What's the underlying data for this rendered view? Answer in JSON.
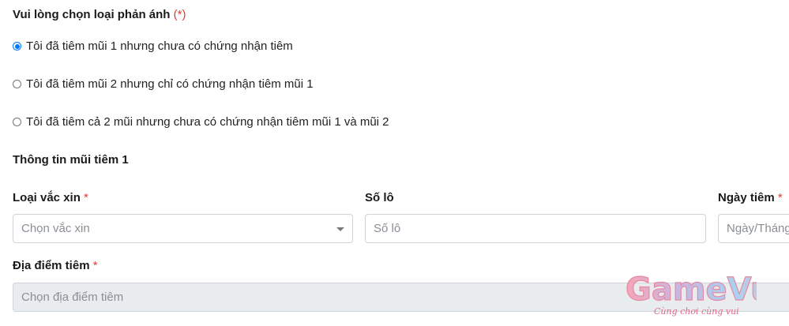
{
  "form": {
    "question": "Vui lòng chọn loại phản ánh",
    "question_required": "(*)",
    "options": [
      {
        "label": "Tôi đã tiêm mũi 1 nhưng chưa có chứng nhận tiêm",
        "checked": true
      },
      {
        "label": "Tôi đã tiêm mũi 2 nhưng chỉ có chứng nhận tiêm mũi 1",
        "checked": false
      },
      {
        "label": "Tôi đã tiêm cả 2 mũi nhưng chưa có chứng nhận tiêm mũi 1 và mũi 2",
        "checked": false
      }
    ],
    "section_title": "Thông tin mũi tiêm 1",
    "vaccine_label": "Loại vắc xin",
    "vaccine_placeholder": "Chọn vắc xin",
    "lot_label": "Số lô",
    "lot_placeholder": "Số lô",
    "date_label": "Ngày tiêm",
    "date_placeholder": "Ngày/Tháng",
    "location_label": "Địa điểm tiêm",
    "location_placeholder": "Chọn địa điểm tiêm",
    "required_mark": "*"
  },
  "watermark": {
    "title": "GameVui",
    "subtitle": "Cùng chơi cùng vui"
  },
  "colors": {
    "required": "#e53935",
    "radio_checked": "#0075ff",
    "disabled_bg": "#e9ecef",
    "watermark_pink": "#e06a8a"
  }
}
